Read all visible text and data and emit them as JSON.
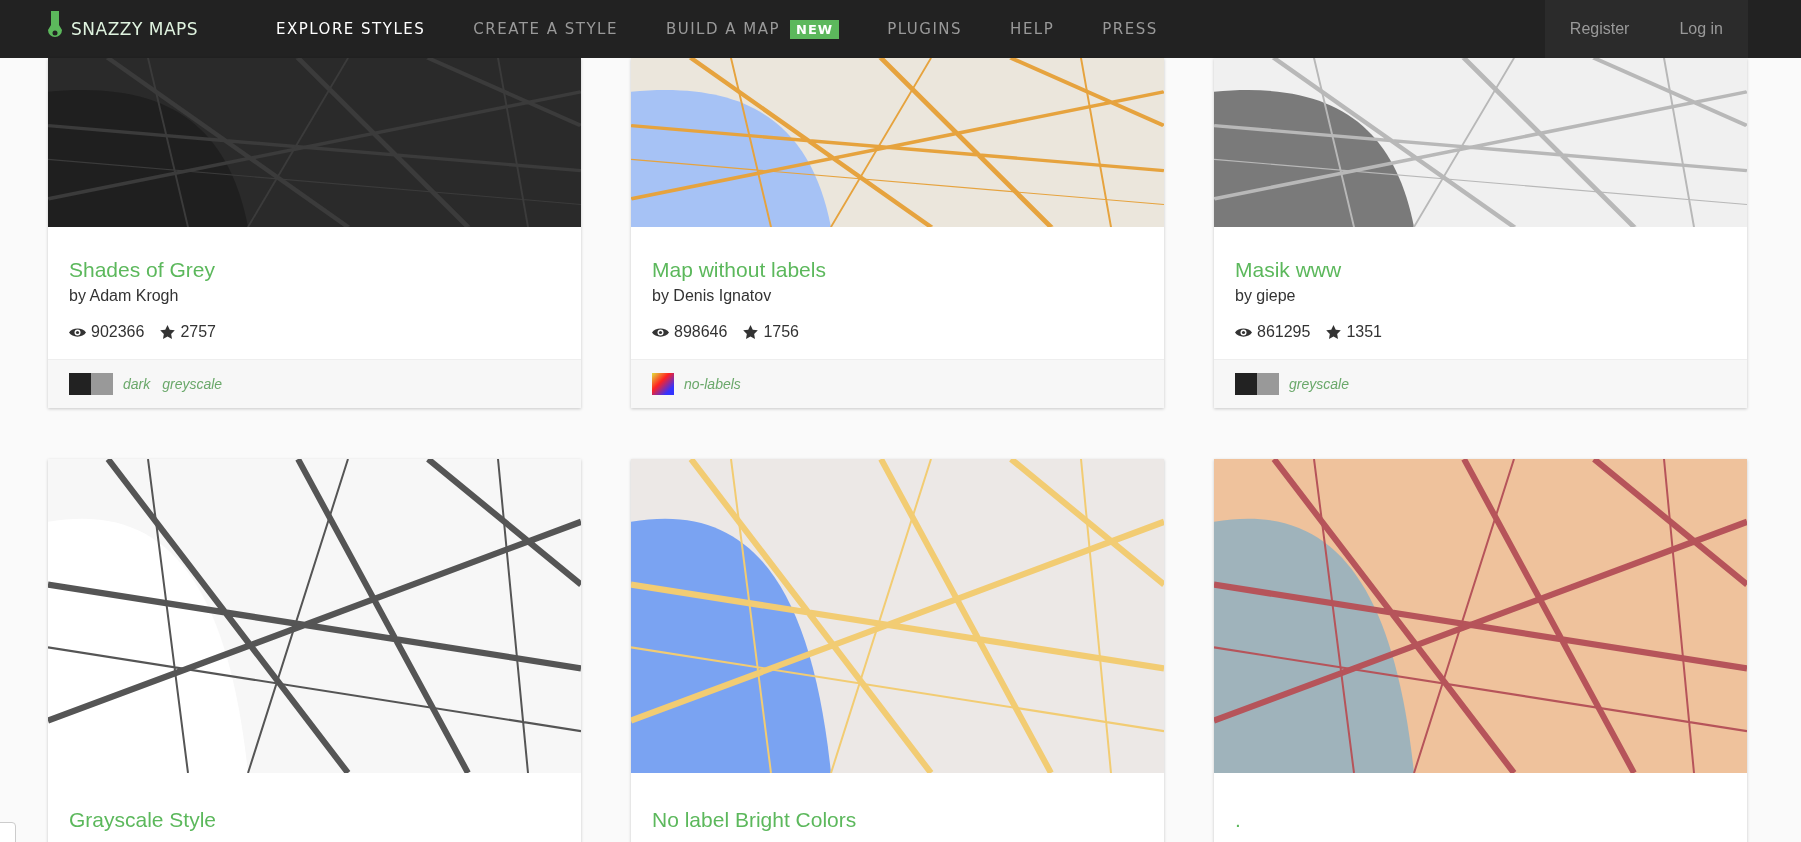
{
  "nav": {
    "brand": "SNAZZY MAPS",
    "items": [
      {
        "label": "EXPLORE STYLES",
        "selected": true
      },
      {
        "label": "CREATE A STYLE",
        "selected": false
      },
      {
        "label": "BUILD A MAP",
        "selected": false,
        "badge": "NEW"
      },
      {
        "label": "PLUGINS",
        "selected": false
      },
      {
        "label": "HELP",
        "selected": false
      },
      {
        "label": "PRESS",
        "selected": false
      }
    ],
    "account": [
      "Register",
      "Log in"
    ]
  },
  "cards": [
    {
      "kind": "dark",
      "title": "Shades of Grey",
      "author": "by Adam Krogh",
      "views": "902366",
      "favorites": "2757",
      "swatch": {
        "kind": "pair",
        "colors": [
          {
            "color": "#222222"
          },
          {
            "color": "#999999"
          }
        ]
      },
      "tags": [
        "dark",
        "greyscale"
      ]
    },
    {
      "kind": "light",
      "title": "Map without labels",
      "author": "by Denis Ignatov",
      "views": "898646",
      "favorites": "1756",
      "swatch": {
        "kind": "rainbow"
      },
      "tags": [
        "no-labels"
      ]
    },
    {
      "kind": "grey",
      "title": "Masik www",
      "author": "by giepe",
      "views": "861295",
      "favorites": "1351",
      "swatch": {
        "kind": "pair",
        "colors": [
          {
            "color": "#222222"
          },
          {
            "color": "#999999"
          }
        ]
      },
      "tags": [
        "greyscale"
      ]
    },
    {
      "kind": "white",
      "title": "Grayscale Style"
    },
    {
      "kind": "bright",
      "title": "No label Bright Colors"
    },
    {
      "kind": "warm",
      "title": "."
    }
  ]
}
